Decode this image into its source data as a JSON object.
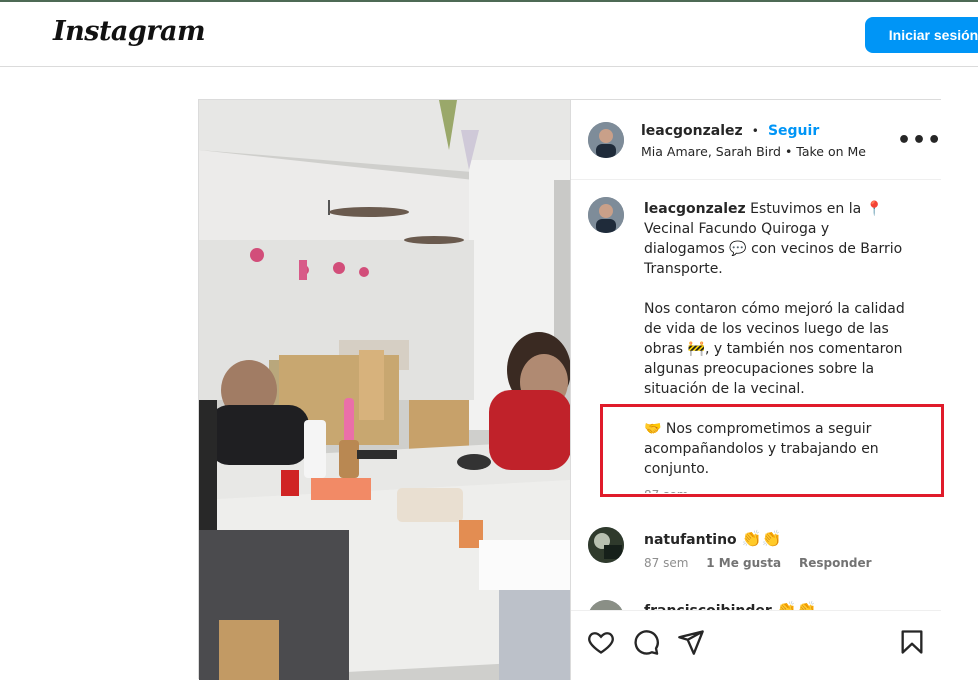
{
  "header": {
    "logo": "Instagram",
    "login_label": "Iniciar sesión"
  },
  "post": {
    "username": "leacgonzalez",
    "dot": "•",
    "follow_label": "Seguir",
    "audio": "Mia Amare, Sarah Bird • Take on Me",
    "more": "•••",
    "caption": {
      "p1": "Estuvimos en la 📍 Vecinal Facundo Quiroga y dialogamos 💬 con vecinos de Barrio Transporte.",
      "p2": "Nos contaron cómo mejoró la calidad de vida de los vecinos luego de las obras 🚧, y también nos comentaron algunas preocupaciones sobre la situación de la vecinal.",
      "p3": "🤝 Nos comprometimos a seguir acompañandolos y trabajando en conjunto.",
      "time": "87 sem"
    },
    "comments": [
      {
        "username": "natufantino",
        "text": "👏👏",
        "time": "87 sem",
        "likes": "1 Me gusta",
        "reply": "Responder"
      },
      {
        "username": "franciscoibinder",
        "text": "👏👏"
      }
    ]
  },
  "icons": [
    "heart-icon",
    "comment-icon",
    "share-icon",
    "bookmark-icon",
    "more-icon"
  ],
  "colors": {
    "accent": "#0095f6",
    "highlight_box": "#e01b2a"
  }
}
